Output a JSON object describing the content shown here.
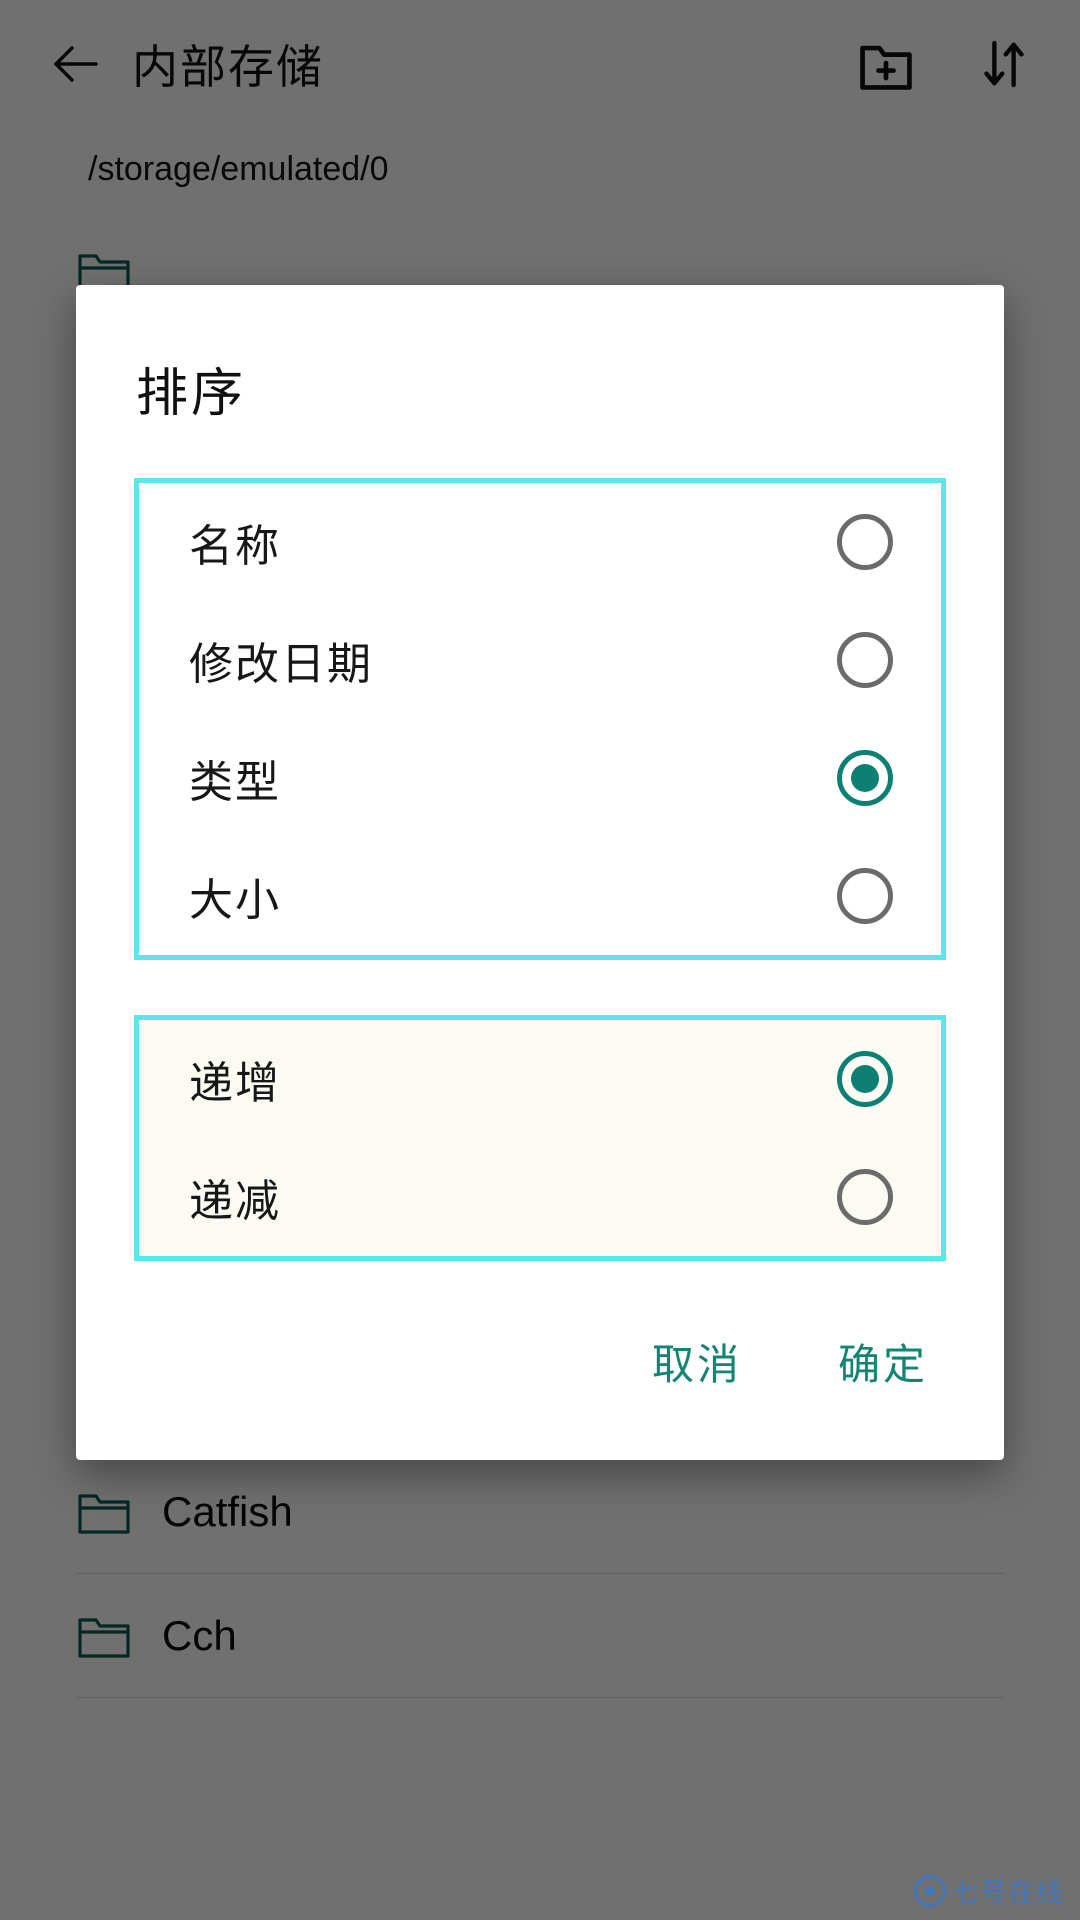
{
  "appbar": {
    "back_icon": "back-arrow-icon",
    "title": "内部存储",
    "new_folder_icon": "new-folder-icon",
    "sort_icon": "sort-arrows-icon"
  },
  "path_bar": {
    "path": "/storage/emulated/0"
  },
  "file_list": {
    "items": [
      {
        "name": "",
        "icon": "folder-icon"
      },
      {
        "name": "",
        "icon": "folder-icon"
      },
      {
        "name": "",
        "icon": "folder-icon"
      },
      {
        "name": "",
        "icon": "folder-icon"
      },
      {
        "name": "",
        "icon": "folder-icon"
      },
      {
        "name": "",
        "icon": "folder-icon"
      },
      {
        "name": "",
        "icon": "folder-icon"
      },
      {
        "name": "",
        "icon": "folder-icon"
      },
      {
        "name": "",
        "icon": "folder-icon"
      },
      {
        "name": "",
        "icon": "folder-icon"
      },
      {
        "name": "Catfish",
        "icon": "folder-icon"
      },
      {
        "name": "Cch",
        "icon": "folder-icon"
      }
    ]
  },
  "dialog": {
    "title": "排序",
    "sort_by_group": {
      "highlighted": true,
      "options": [
        {
          "label": "名称",
          "selected": false
        },
        {
          "label": "修改日期",
          "selected": false
        },
        {
          "label": "类型",
          "selected": true
        },
        {
          "label": "大小",
          "selected": false
        }
      ]
    },
    "order_group": {
      "highlighted": true,
      "options": [
        {
          "label": "递增",
          "selected": true
        },
        {
          "label": "递减",
          "selected": false
        }
      ]
    },
    "cancel_label": "取消",
    "confirm_label": "确定"
  },
  "watermark": {
    "text": "七号在线"
  },
  "colors": {
    "accent_teal": "#0d8073",
    "highlight_cyan": "#5de5ec",
    "button_text": "#128472",
    "scrim": "rgba(0,0,0,0.56)",
    "watermark_blue": "#3f77bf"
  }
}
